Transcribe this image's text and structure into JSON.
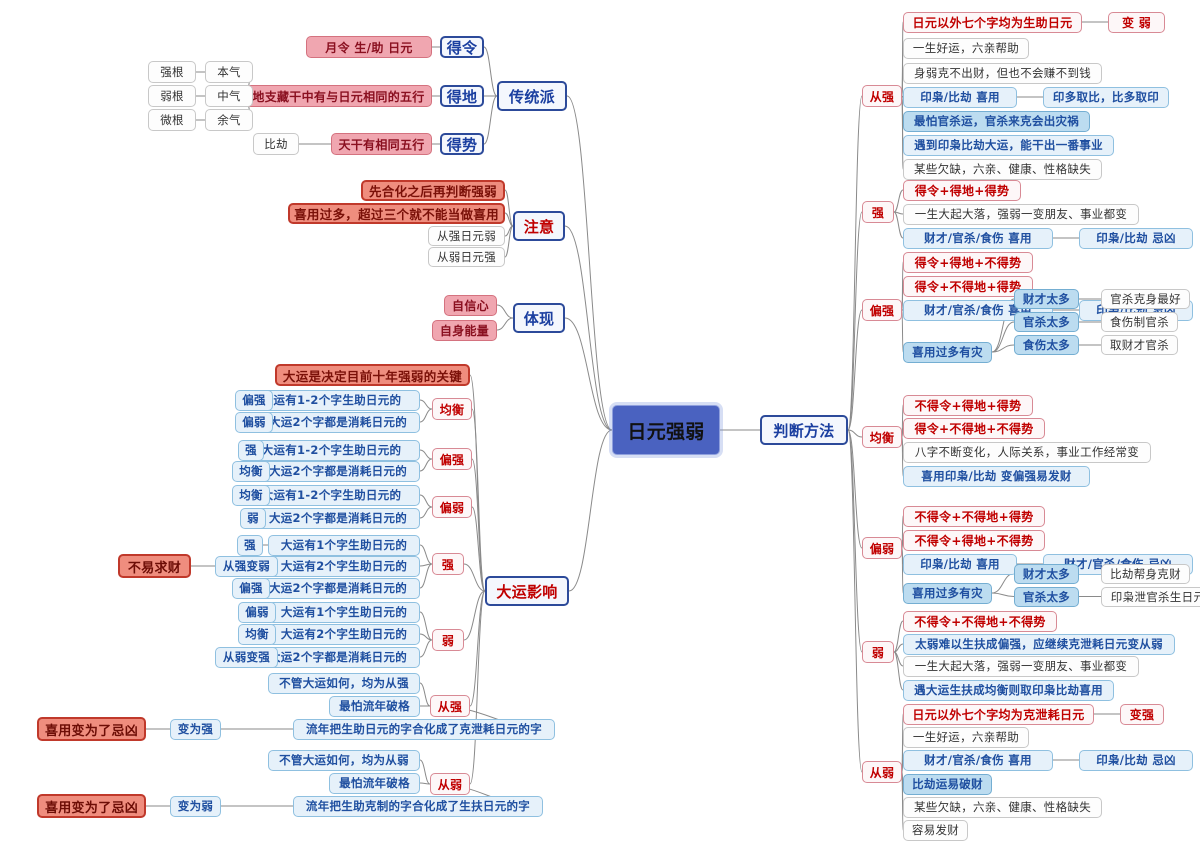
{
  "root": {
    "label": "日元强弱"
  },
  "method_node": {
    "label": "判断方法"
  },
  "left": {
    "traditional": {
      "label": "传统派",
      "rows": [
        {
          "label": "得令",
          "detail": "月令 生/助 日元"
        },
        {
          "label": "得地",
          "detail": "地支藏干中有与日元相同的五行"
        },
        {
          "label": "得势",
          "detail": "天干有相同五行"
        }
      ],
      "roots": [
        {
          "strength": "强根",
          "qi": "本气"
        },
        {
          "strength": "弱根",
          "qi": "中气"
        },
        {
          "strength": "微根",
          "qi": "余气"
        }
      ],
      "bijie": "比劫"
    },
    "attention": {
      "label": "注意",
      "items": [
        {
          "text": "先合化之后再判断强弱",
          "style": "salmon"
        },
        {
          "text": "喜用过多，超过三个就不能当做喜用",
          "style": "salmon"
        },
        {
          "text": "从强日元弱",
          "style": "white"
        },
        {
          "text": "从弱日元强",
          "style": "white"
        }
      ]
    },
    "manifest": {
      "label": "体现",
      "items": [
        "自信心",
        "自身能量"
      ]
    },
    "luck": {
      "label": "大运影响",
      "headline": "大运是决定目前十年强弱的关键",
      "groups": [
        {
          "result": "均衡",
          "rows": [
            {
              "from": "偏强",
              "cond": "大运有1-2个字生助日元的"
            },
            {
              "from": "偏弱",
              "cond": "大运2个字都是消耗日元的"
            }
          ]
        },
        {
          "result": "偏强",
          "rows": [
            {
              "from": "强",
              "cond": "大运有1-2个字生助日元的"
            },
            {
              "from": "均衡",
              "cond": "大运2个字都是消耗日元的"
            }
          ]
        },
        {
          "result": "偏弱",
          "rows": [
            {
              "from": "均衡",
              "cond": "大运有1-2个字生助日元的"
            },
            {
              "from": "弱",
              "cond": "大运2个字都是消耗日元的"
            }
          ]
        },
        {
          "result": "强",
          "rows": [
            {
              "from": "强",
              "cond": "大运有1个字生助日元的"
            },
            {
              "from": "从强变弱",
              "cond": "大运有2个字生助日元的",
              "extra": "不易求财"
            },
            {
              "from": "偏强",
              "cond": "大运2个字都是消耗日元的"
            }
          ]
        },
        {
          "result": "弱",
          "rows": [
            {
              "from": "偏弱",
              "cond": "大运有1个字生助日元的"
            },
            {
              "from": "均衡",
              "cond": "大运有2个字生助日元的"
            },
            {
              "from": "从弱变强",
              "cond": "大运2个字都是消耗日元的"
            }
          ]
        },
        {
          "result": "从强",
          "rows": [
            {
              "cond": "不管大运如何，均为从强"
            },
            {
              "cond": "最怕流年破格"
            },
            {
              "cond": "流年把生助日元的字合化成了克泄耗日元的字",
              "from": "变为强",
              "extra": "喜用变为了忌凶"
            }
          ]
        },
        {
          "result": "从弱",
          "rows": [
            {
              "cond": "不管大运如何，均为从弱"
            },
            {
              "cond": "最怕流年破格"
            },
            {
              "cond": "流年把生助克制的字合化成了生扶日元的字",
              "from": "变为弱",
              "extra": "喜用变为了忌凶"
            }
          ]
        }
      ]
    }
  },
  "right": {
    "branches": [
      {
        "label": "从强",
        "items": [
          {
            "text": "日元以外七个字均为生助日元",
            "style": "redout",
            "child": {
              "text": "变 弱",
              "style": "redout"
            }
          },
          {
            "text": "一生好运，六亲帮助",
            "style": "white"
          },
          {
            "text": "身弱克不出财，但也不会赚不到钱",
            "style": "white"
          },
          {
            "text": "印枭/比劫 喜用",
            "style": "lightblue",
            "child": {
              "text": "印多取比，比多取印",
              "style": "lightblue"
            }
          },
          {
            "text": "最怕官杀运，官杀来克会出灾祸",
            "style": "midblue"
          },
          {
            "text": "遇到印枭比劫大运，能干出一番事业",
            "style": "lightblue"
          },
          {
            "text": "某些欠缺，六亲、健康、性格缺失",
            "style": "white"
          }
        ]
      },
      {
        "label": "强",
        "items": [
          {
            "text": "得令+得地+得势",
            "style": "redout"
          },
          {
            "text": "一生大起大落，强弱一变朋友、事业都变",
            "style": "white"
          },
          {
            "text": "财才/官杀/食伤 喜用",
            "style": "lightblue",
            "child": {
              "text": "印枭/比劫 忌凶",
              "style": "lightblue"
            }
          }
        ]
      },
      {
        "label": "偏强",
        "items": [
          {
            "text": "得令+得地+不得势",
            "style": "redout"
          },
          {
            "text": "得令+不得地+得势",
            "style": "redout"
          },
          {
            "text": "财才/官杀/食伤 喜用",
            "style": "lightblue",
            "child": {
              "text": "印枭/比劫 忌凶",
              "style": "lightblue"
            }
          },
          {
            "text": "喜用过多有灾",
            "style": "midblue",
            "children": [
              {
                "text": "财才太多",
                "style": "midblue",
                "child": {
                  "text": "官杀克身最好",
                  "style": "white"
                }
              },
              {
                "text": "官杀太多",
                "style": "midblue",
                "child": {
                  "text": "食伤制官杀",
                  "style": "white"
                }
              },
              {
                "text": "食伤太多",
                "style": "midblue",
                "child": {
                  "text": "取财才官杀",
                  "style": "white"
                }
              }
            ]
          }
        ]
      },
      {
        "label": "均衡",
        "items": [
          {
            "text": "不得令+得地+得势",
            "style": "redout"
          },
          {
            "text": "得令+不得地+不得势",
            "style": "redout"
          },
          {
            "text": "八字不断变化，人际关系，事业工作经常变",
            "style": "white"
          },
          {
            "text": "喜用印枭/比劫 变偏强易发财",
            "style": "lightblue"
          }
        ]
      },
      {
        "label": "偏弱",
        "items": [
          {
            "text": "不得令+不得地+得势",
            "style": "redout"
          },
          {
            "text": "不得令+得地+不得势",
            "style": "redout"
          },
          {
            "text": "印枭/比劫 喜用",
            "style": "lightblue",
            "child": {
              "text": "财才/官杀/食伤 忌凶",
              "style": "lightblue"
            }
          },
          {
            "text": "喜用过多有灾",
            "style": "midblue",
            "children": [
              {
                "text": "财才太多",
                "style": "midblue",
                "child": {
                  "text": "比劫帮身克财",
                  "style": "white"
                }
              },
              {
                "text": "官杀太多",
                "style": "midblue",
                "child": {
                  "text": "印枭泄官杀生日元",
                  "style": "white"
                }
              }
            ]
          }
        ]
      },
      {
        "label": "弱",
        "items": [
          {
            "text": "不得令+不得地+不得势",
            "style": "redout"
          },
          {
            "text": "太弱难以生扶成偏强，应继续克泄耗日元变从弱",
            "style": "lightblue"
          },
          {
            "text": "一生大起大落，强弱一变朋友、事业都变",
            "style": "white"
          },
          {
            "text": "遇大运生扶成均衡则取印枭比劫喜用",
            "style": "lightblue"
          }
        ]
      },
      {
        "label": "从弱",
        "items": [
          {
            "text": "日元以外七个字均为克泄耗日元",
            "style": "redout",
            "child": {
              "text": "变强",
              "style": "redout"
            }
          },
          {
            "text": "一生好运，六亲帮助",
            "style": "white"
          },
          {
            "text": "财才/官杀/食伤 喜用",
            "style": "lightblue",
            "child": {
              "text": "印枭/比劫 忌凶",
              "style": "lightblue"
            }
          },
          {
            "text": "比劫运易破财",
            "style": "midblue"
          },
          {
            "text": "某些欠缺，六亲、健康、性格缺失",
            "style": "white"
          },
          {
            "text": "容易发财",
            "style": "white"
          }
        ]
      }
    ]
  },
  "colors": {
    "root_fill": "#4a62c0",
    "main_border": "#2c4a9a",
    "red_text": "#c00000",
    "blue_text": "#1f4fa0",
    "light_blue_fill": "#e6f1fa",
    "mid_blue_fill": "#bcdcf0",
    "pink_fill": "#f0a6b0",
    "salmon_fill": "#ef8d7e",
    "link": "#8a8a8a"
  }
}
